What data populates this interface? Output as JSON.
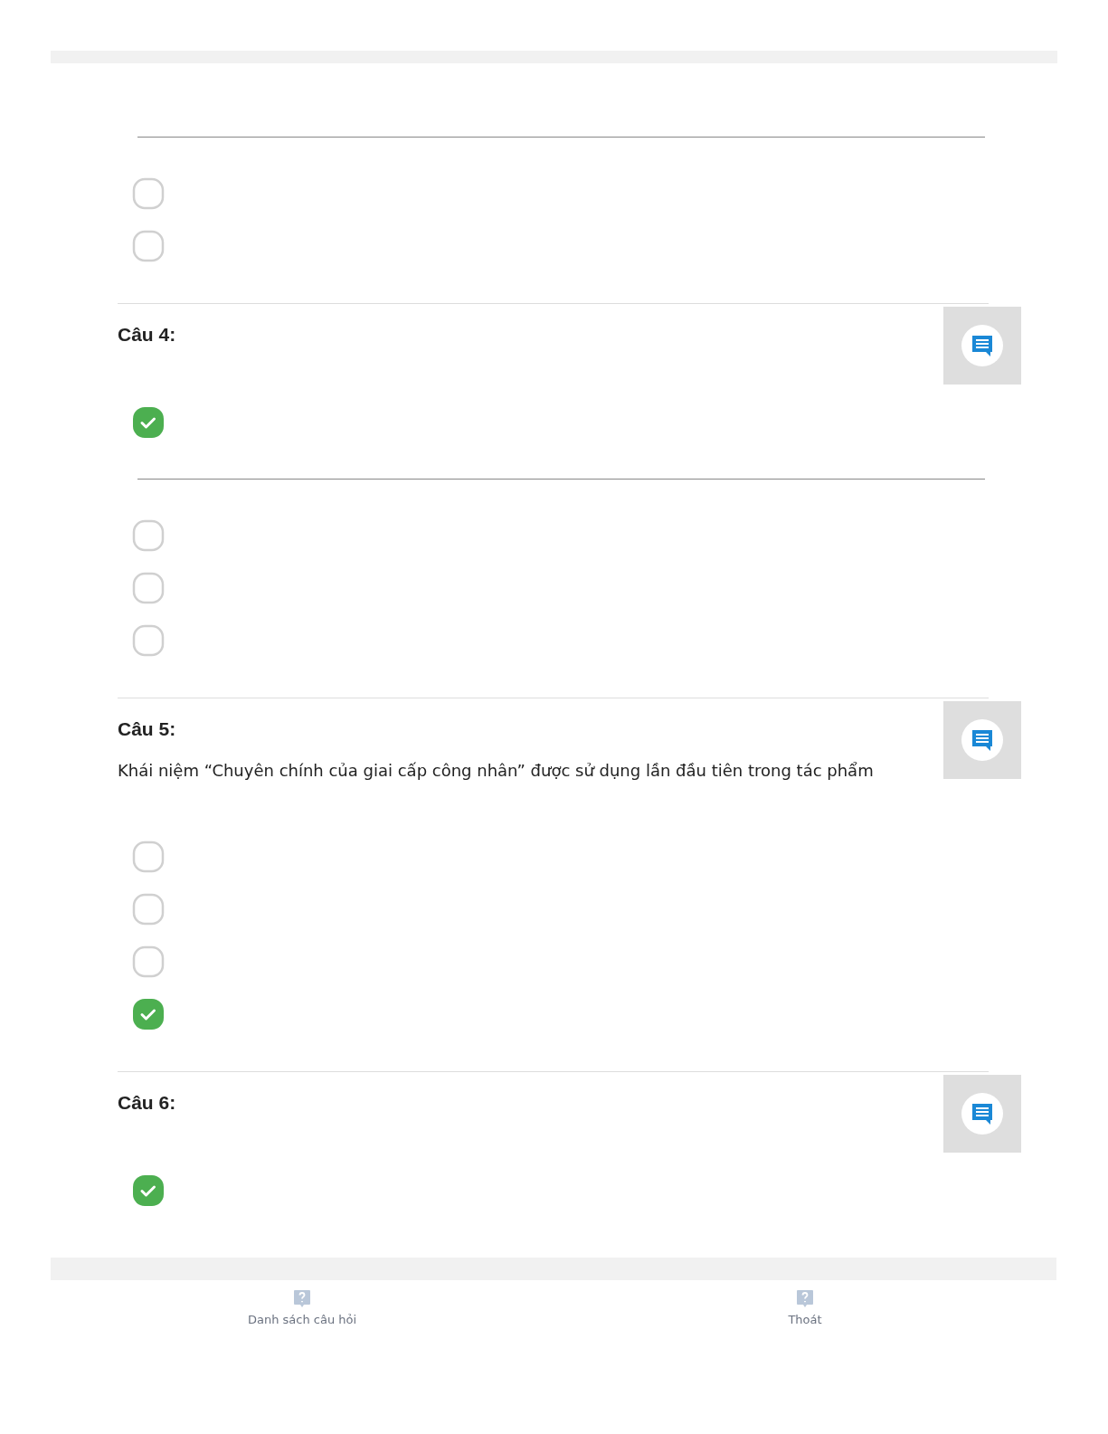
{
  "questions": [
    {
      "options": [
        {
          "kind": "rule"
        },
        {
          "kind": "choice",
          "checked": false
        },
        {
          "kind": "choice",
          "checked": false
        }
      ]
    },
    {
      "label": "Câu 4:",
      "comment": true,
      "options": [
        {
          "kind": "choice",
          "checked": true
        },
        {
          "kind": "rule"
        },
        {
          "kind": "choice",
          "checked": false
        },
        {
          "kind": "choice",
          "checked": false
        },
        {
          "kind": "choice",
          "checked": false
        }
      ]
    },
    {
      "label": "Câu 5:",
      "comment": true,
      "text": "Khái niệm “Chuyên chính của giai cấp công nhân” được sử dụng lần đầu tiên trong tác phẩm",
      "options": [
        {
          "kind": "choice",
          "checked": false
        },
        {
          "kind": "choice",
          "checked": false
        },
        {
          "kind": "choice",
          "checked": false
        },
        {
          "kind": "choice",
          "checked": true
        }
      ]
    },
    {
      "label": "Câu 6:",
      "comment": true,
      "options": [
        {
          "kind": "choice",
          "checked": true
        }
      ]
    }
  ],
  "bottom_nav": [
    {
      "label": "Danh sách câu hỏi"
    },
    {
      "label": "Thoát"
    }
  ]
}
